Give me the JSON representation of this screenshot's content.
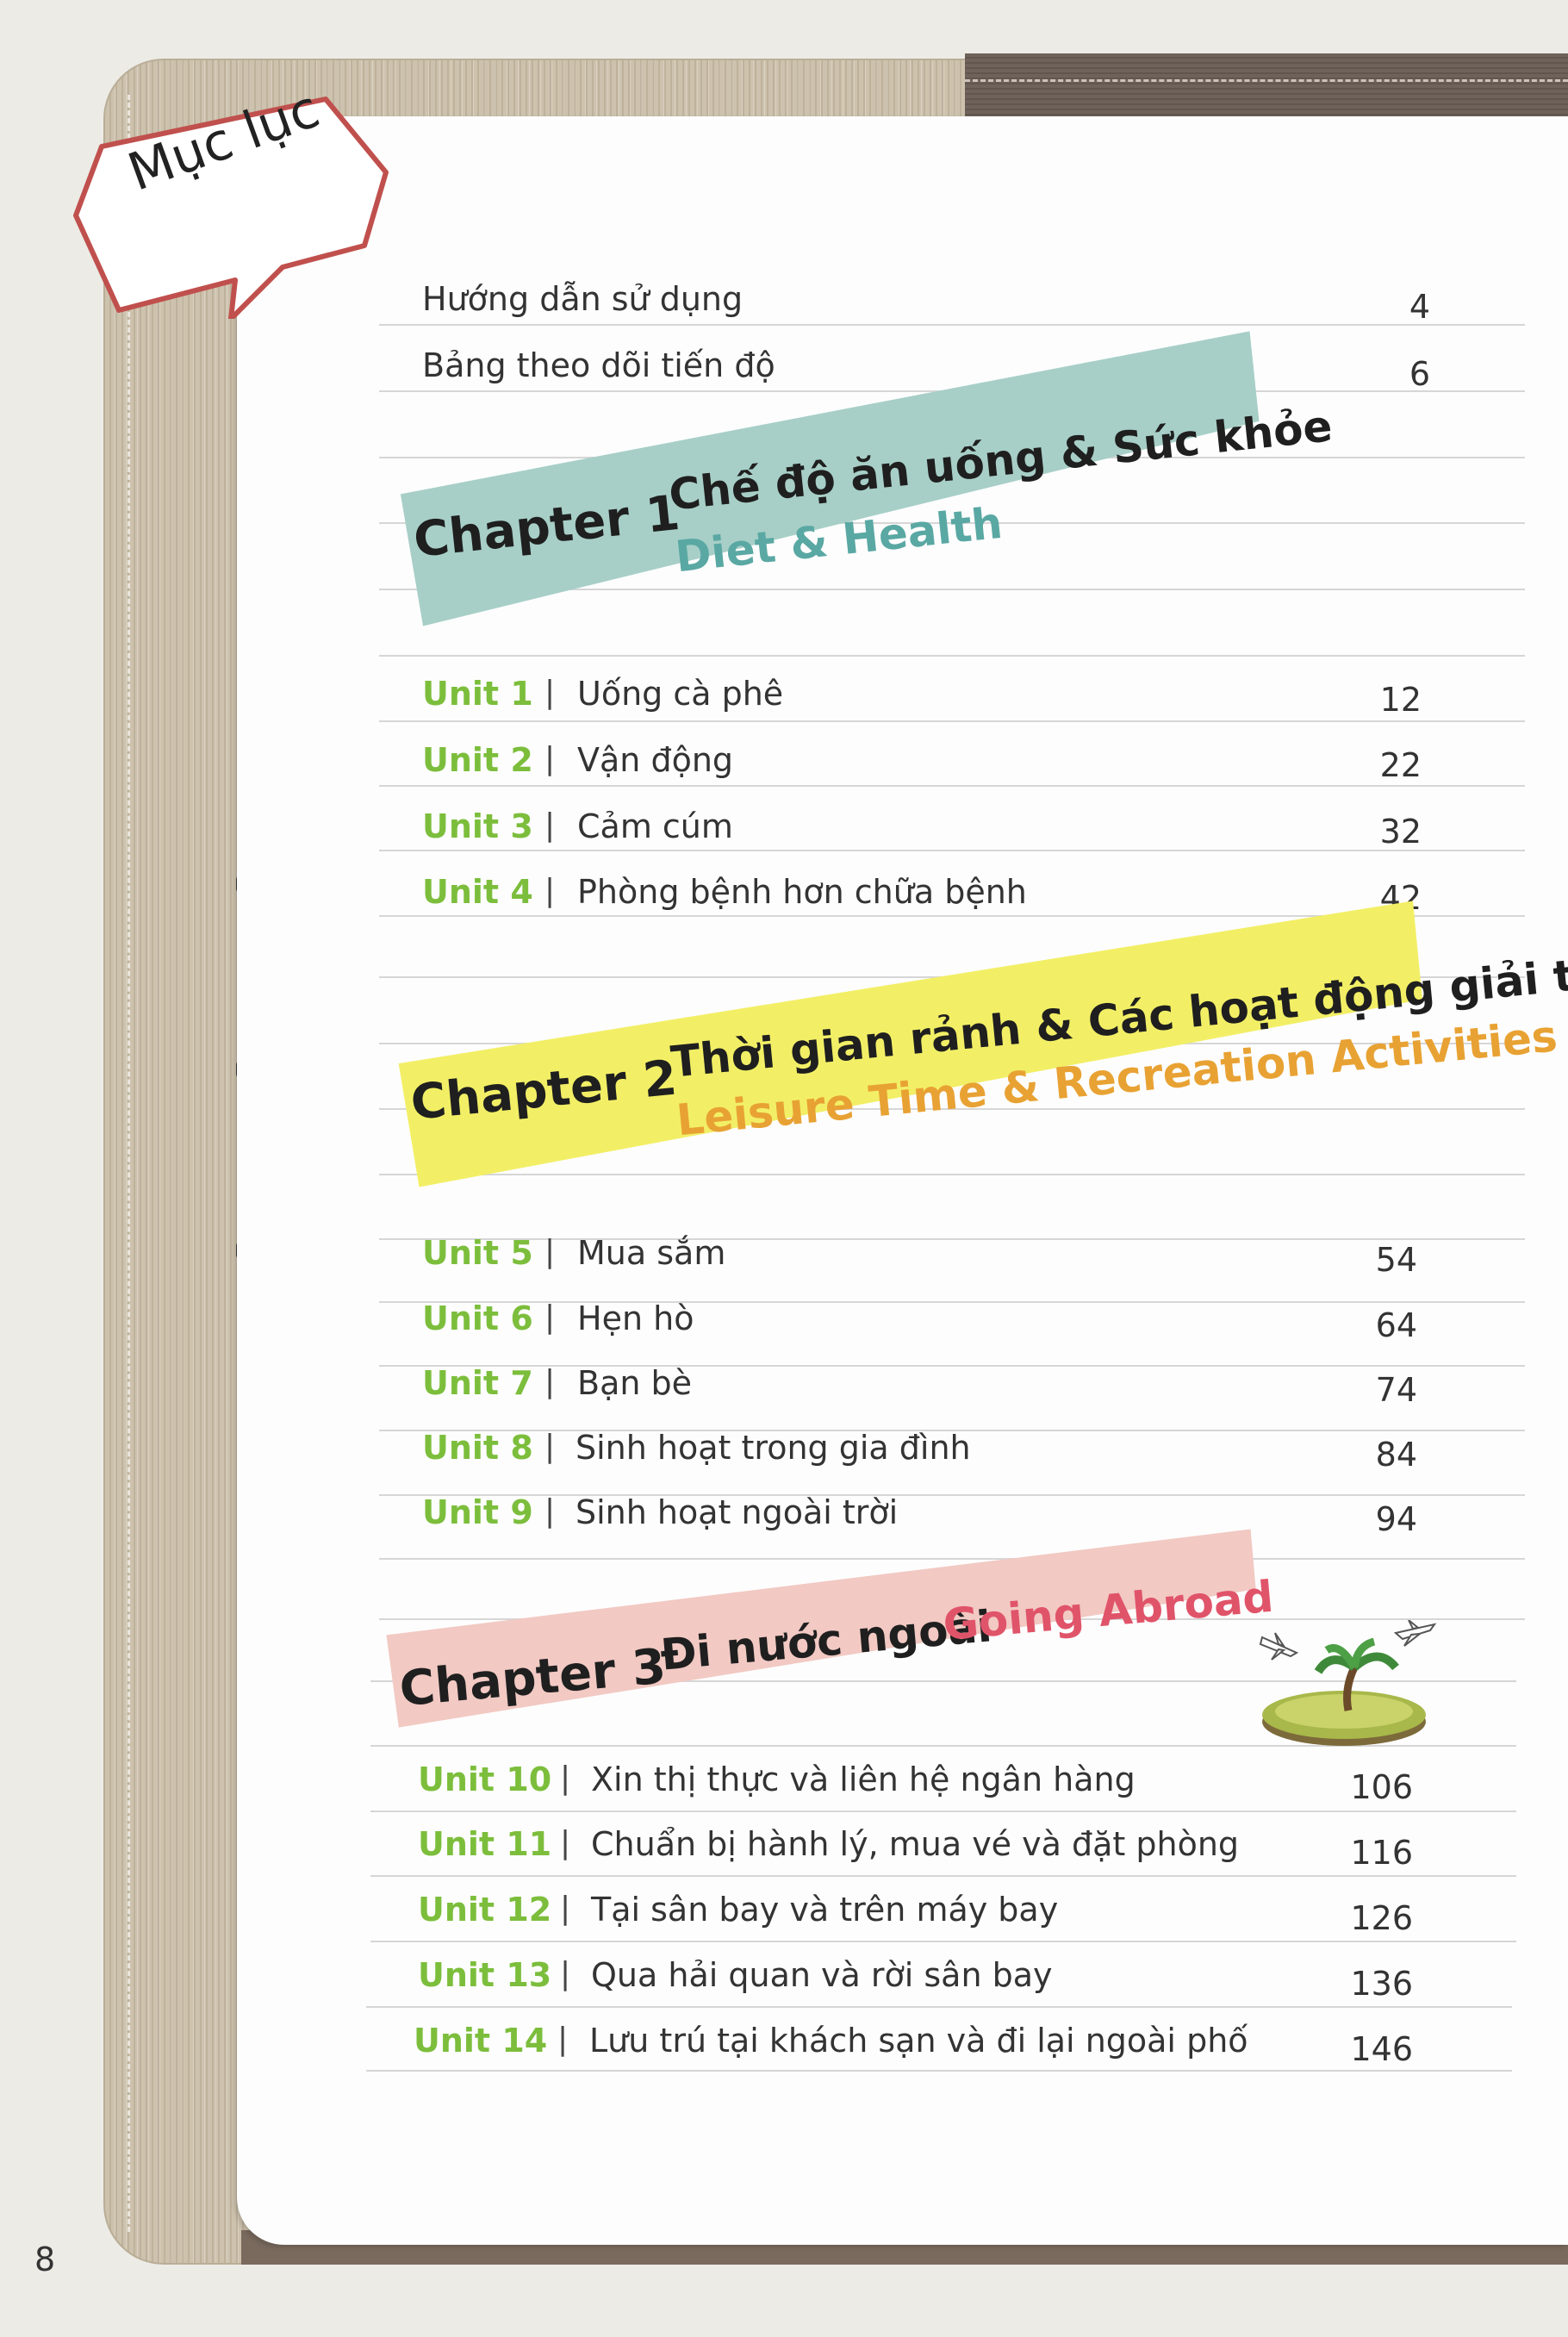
{
  "header": {
    "title": "Mục lục"
  },
  "intro_items": [
    {
      "label": "Hướng dẫn sử dụng",
      "page": "4"
    },
    {
      "label": "Bảng theo dõi tiến độ",
      "page": "6"
    }
  ],
  "chapters": [
    {
      "label": "Chapter 1",
      "title_vn": "Chế độ ăn uống & Sức khỏe",
      "title_en": "Diet & Health",
      "band_color": "#a7cfc7",
      "en_color": "#5aa8a3",
      "units": [
        {
          "unit": "Unit 1",
          "title": "Uống cà phê",
          "page": "12"
        },
        {
          "unit": "Unit 2",
          "title": "Vận động",
          "page": "22"
        },
        {
          "unit": "Unit 3",
          "title": "Cảm cúm",
          "page": "32"
        },
        {
          "unit": "Unit 4",
          "title": "Phòng bệnh hơn chữa bệnh",
          "page": "42"
        }
      ]
    },
    {
      "label": "Chapter 2",
      "title_vn": "Thời gian rảnh & Các hoạt động giải trí",
      "title_en": "Leisure Time & Recreation Activities",
      "band_color": "#f2ef66",
      "en_color": "#e8a233",
      "units": [
        {
          "unit": "Unit 5",
          "title": "Mua sắm",
          "page": "54"
        },
        {
          "unit": "Unit 6",
          "title": "Hẹn hò",
          "page": "64"
        },
        {
          "unit": "Unit 7",
          "title": "Bạn bè",
          "page": "74"
        },
        {
          "unit": "Unit 8",
          "title": "Sinh hoạt trong gia đình",
          "page": "84"
        },
        {
          "unit": "Unit 9",
          "title": "Sinh hoạt ngoài trời",
          "page": "94"
        }
      ]
    },
    {
      "label": "Chapter 3",
      "title_vn": "Đi nước ngoài",
      "title_en": "Going Abroad",
      "band_color": "#f2c9c3",
      "en_color": "#e0546a",
      "units": [
        {
          "unit": "Unit 10",
          "title": "Xin thị thực và liên hệ ngân hàng",
          "page": "106"
        },
        {
          "unit": "Unit 11",
          "title": "Chuẩn bị hành lý, mua vé và đặt phòng",
          "page": "116"
        },
        {
          "unit": "Unit 12",
          "title": "Tại sân bay và trên máy bay",
          "page": "126"
        },
        {
          "unit": "Unit 13",
          "title": "Qua hải quan và rời sân bay",
          "page": "136"
        },
        {
          "unit": "Unit 14",
          "title": "Lưu trú tại khách sạn và đi lại ngoài phố",
          "page": "146"
        }
      ]
    }
  ],
  "footer": {
    "page_number": "8"
  }
}
